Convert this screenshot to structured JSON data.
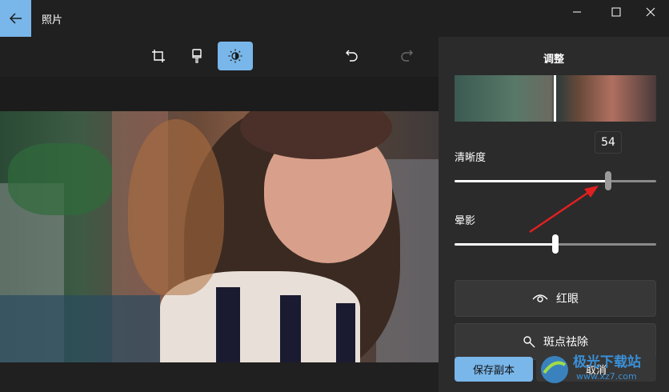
{
  "window": {
    "title": "照片",
    "back_icon": "arrow-left-icon",
    "controls": [
      "minimize-icon",
      "maximize-icon",
      "close-icon"
    ]
  },
  "toolbar": {
    "tools": [
      {
        "name": "crop",
        "icon": "crop-icon",
        "active": false
      },
      {
        "name": "markup",
        "icon": "brush-icon",
        "active": false
      },
      {
        "name": "adjust",
        "icon": "brightness-icon",
        "active": true
      }
    ],
    "undo_icon": "undo-icon",
    "redo_icon": "redo-icon",
    "redo_enabled": false
  },
  "panel": {
    "title": "调整",
    "sliders": [
      {
        "label": "清晰度",
        "value": 54,
        "fraction": 0.76,
        "tooltip": "54"
      },
      {
        "label": "晕影",
        "value": 0,
        "fraction": 0.5
      }
    ],
    "buttons": [
      {
        "label": "红眼",
        "icon": "eye-icon"
      },
      {
        "label": "斑点祛除",
        "icon": "spot-fix-icon"
      }
    ],
    "save_label": "保存副本",
    "cancel_label": "取消"
  },
  "watermark": {
    "line1": "极光下载站",
    "line2": "www.xz7.com"
  },
  "colors": {
    "accent": "#79b6e9",
    "background": "#202020",
    "panel": "#2b2b2b",
    "annotation_arrow": "#e02020"
  }
}
